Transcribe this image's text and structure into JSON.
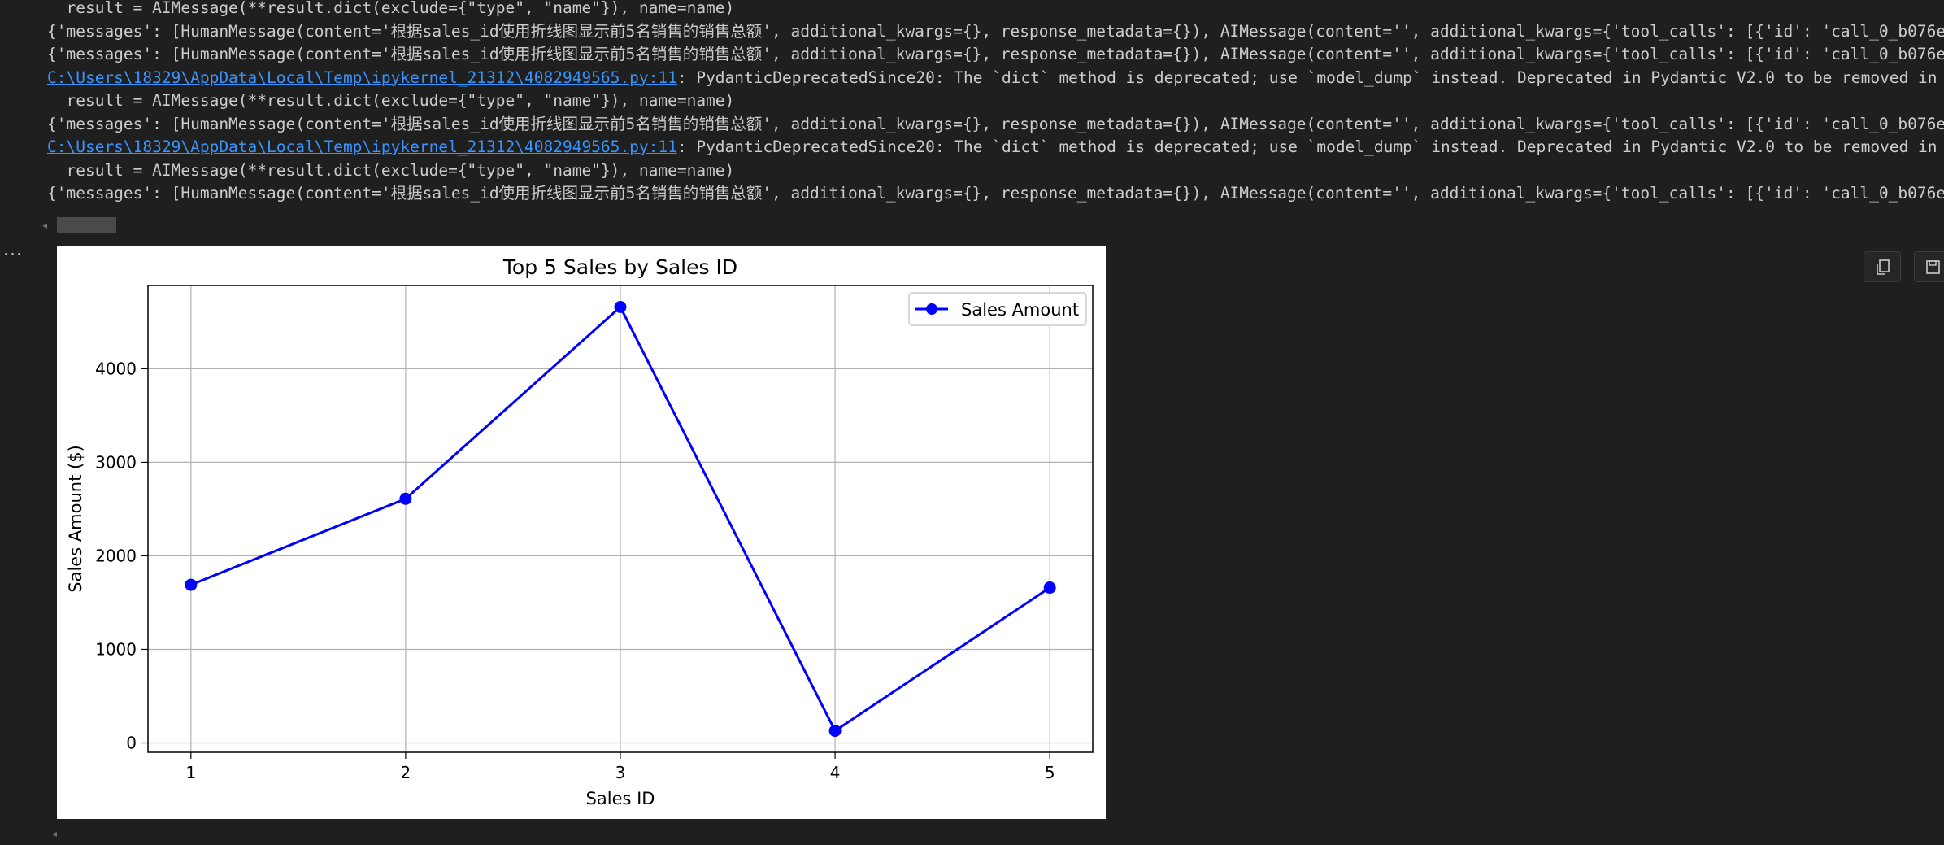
{
  "output_lines": [
    {
      "kind": "code",
      "text": "  result = AIMessage(**result.dict(exclude={\"type\", \"name\"}), name=name)"
    },
    {
      "kind": "msg",
      "text": "{'messages': [HumanMessage(content='根据sales_id使用折线图显示前5名销售的销售总额', additional_kwargs={}, response_metadata={}), AIMessage(content='', additional_kwargs={'tool_calls': [{'id': 'call_0_b076eb"
    },
    {
      "kind": "msg",
      "text": "{'messages': [HumanMessage(content='根据sales_id使用折线图显示前5名销售的销售总额', additional_kwargs={}, response_metadata={}), AIMessage(content='', additional_kwargs={'tool_calls': [{'id': 'call_0_b076eb"
    },
    {
      "kind": "warn",
      "path": "C:\\Users\\18329\\AppData\\Local\\Temp\\ipykernel_21312\\4082949565.py:11",
      "text": ": PydanticDeprecatedSince20: The `dict` method is deprecated; use `model_dump` instead. Deprecated in Pydantic V2.0 to be removed in V3.0"
    },
    {
      "kind": "code",
      "text": "  result = AIMessage(**result.dict(exclude={\"type\", \"name\"}), name=name)"
    },
    {
      "kind": "msg",
      "text": "{'messages': [HumanMessage(content='根据sales_id使用折线图显示前5名销售的销售总额', additional_kwargs={}, response_metadata={}), AIMessage(content='', additional_kwargs={'tool_calls': [{'id': 'call_0_b076eb"
    },
    {
      "kind": "warn",
      "path": "C:\\Users\\18329\\AppData\\Local\\Temp\\ipykernel_21312\\4082949565.py:11",
      "text": ": PydanticDeprecatedSince20: The `dict` method is deprecated; use `model_dump` instead. Deprecated in Pydantic V2.0 to be removed in V3.0"
    },
    {
      "kind": "code",
      "text": "  result = AIMessage(**result.dict(exclude={\"type\", \"name\"}), name=name)"
    },
    {
      "kind": "msg",
      "text": "{'messages': [HumanMessage(content='根据sales_id使用折线图显示前5名销售的销售总额', additional_kwargs={}, response_metadata={}), AIMessage(content='', additional_kwargs={'tool_calls': [{'id': 'call_0_b076eb"
    }
  ],
  "cell_menu_label": "...",
  "icons": {
    "cell_menu": "ellipsis-icon",
    "copy_button": "copy-icon",
    "save_button": "save-icon"
  },
  "colors": {
    "background": "#1f1f1f",
    "text": "#cccccc",
    "link": "#3794ff",
    "series": "#0000ff"
  },
  "chart_data": {
    "type": "line",
    "title": "Top 5 Sales by Sales ID",
    "xlabel": "Sales ID",
    "ylabel": "Sales Amount ($)",
    "x": [
      1,
      2,
      3,
      4,
      5
    ],
    "series": [
      {
        "name": "Sales Amount",
        "values": [
          1690,
          2610,
          4660,
          130,
          1660
        ],
        "color": "#0000ff",
        "marker": "circle"
      }
    ],
    "xlim": [
      0.8,
      5.2
    ],
    "ylim": [
      -100,
      4890
    ],
    "xticks": [
      1,
      2,
      3,
      4,
      5
    ],
    "yticks": [
      0,
      1000,
      2000,
      3000,
      4000
    ],
    "grid": true,
    "legend": "top-right"
  }
}
